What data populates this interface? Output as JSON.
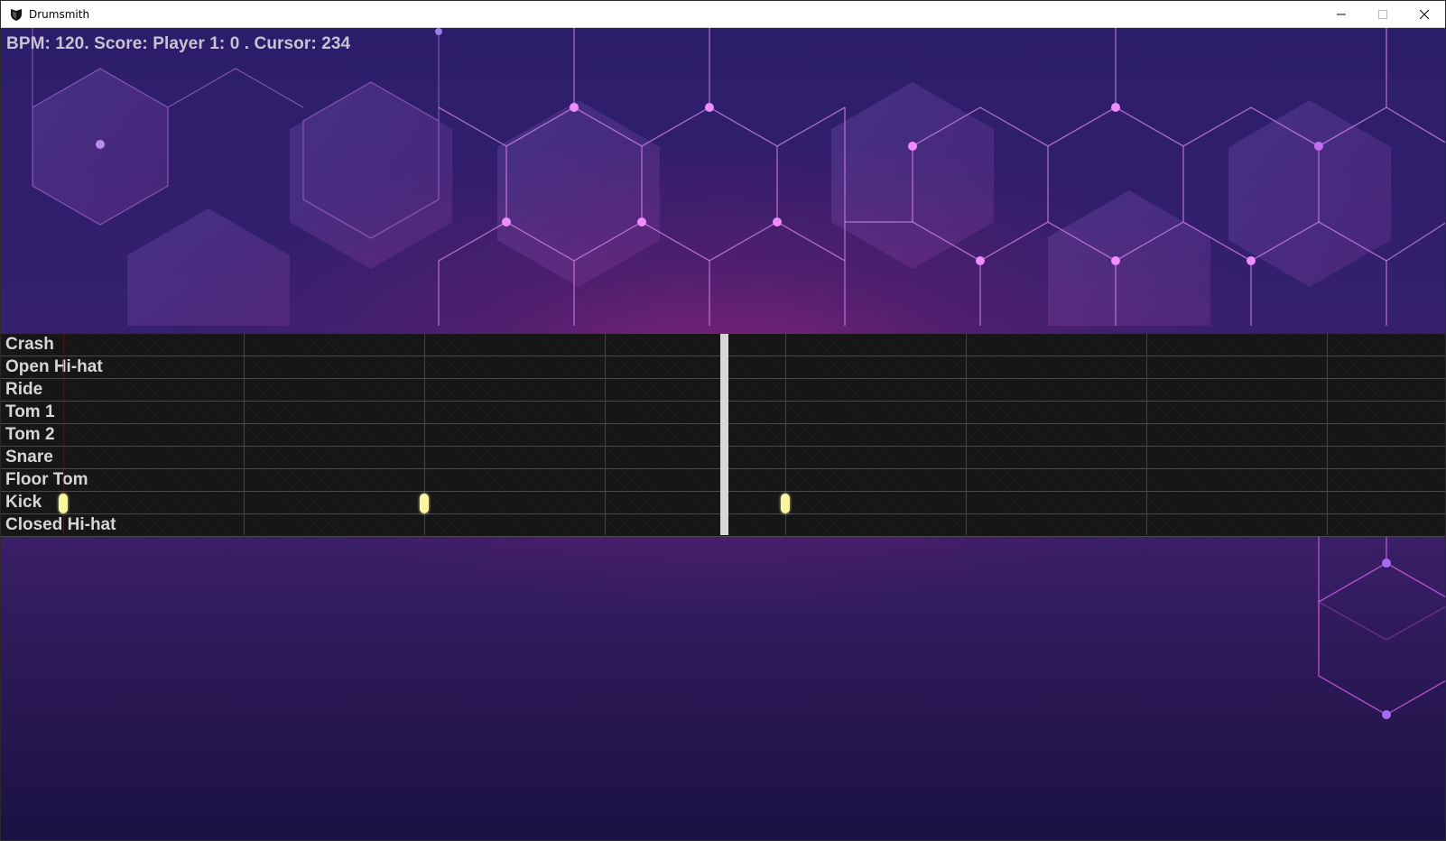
{
  "window": {
    "title": "Drumsmith",
    "app_icon": "shield-icon",
    "controls": [
      "minimize-icon",
      "maximize-icon",
      "close-icon"
    ]
  },
  "hud": {
    "text": "BPM: 120. Score: Player 1: 0 . Cursor: 234"
  },
  "tracks": [
    {
      "label": "Crash"
    },
    {
      "label": "Open Hi-hat"
    },
    {
      "label": "Ride"
    },
    {
      "label": "Tom 1"
    },
    {
      "label": "Tom 2"
    },
    {
      "label": "Snare"
    },
    {
      "label": "Floor Tom"
    },
    {
      "label": "Kick"
    },
    {
      "label": "Closed Hi-hat"
    }
  ],
  "colors": {
    "note": "#fbf6a0",
    "playhead": "#d7d7d7",
    "grid_bg": "#141414",
    "background_top": "#2c1d6b",
    "background_glow": "#8c237d"
  }
}
